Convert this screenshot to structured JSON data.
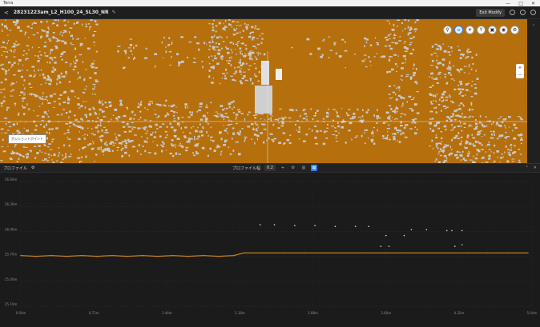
{
  "titlebar": {
    "app": "Terra",
    "minimize": "—",
    "maximize": "□",
    "close": "✕"
  },
  "header": {
    "back": "<",
    "title": "28231223am_L2_H100_24_SL30_NR",
    "edit_mode_label": "Exit Modify"
  },
  "viewport": {
    "position_label": "ポジショントポイント",
    "tools": [
      "pin-icon",
      "layers-icon",
      "bulb-icon",
      "fork-icon",
      "cube-icon",
      "camera-icon",
      "settings-icon"
    ],
    "side_tools": [
      "zoom-in-icon",
      "zoom-out-icon"
    ],
    "colors": {
      "ground": "#b56f0c",
      "noise": "#c9c9c9"
    }
  },
  "chartbar": {
    "left_label": "プロファイル",
    "density_label": "プロファイル幅",
    "density_value": "0.2",
    "zoom_buttons": [
      "0/1",
      "1/1",
      "1/1"
    ]
  },
  "chart_data": {
    "type": "scatter",
    "title": "",
    "xlabel": "",
    "ylabel": "",
    "y_ticks": [
      "26.60m",
      "26.30m",
      "26.00m",
      "25.70m",
      "25.40m",
      "25.10m"
    ],
    "x_ticks": [
      "0.00m",
      "0.72m",
      "1.44m",
      "2.16m",
      "2.88m",
      "3.60m",
      "4.32m",
      "5.04m"
    ],
    "ylim": [
      25.1,
      26.6
    ],
    "xlim": [
      0,
      5.04
    ],
    "series": [
      {
        "color": "#c47f1a",
        "points": [
          [
            0.0,
            25.71
          ],
          [
            0.15,
            25.7
          ],
          [
            0.3,
            25.71
          ],
          [
            0.45,
            25.7
          ],
          [
            0.6,
            25.71
          ],
          [
            0.75,
            25.7
          ],
          [
            0.9,
            25.71
          ],
          [
            1.05,
            25.7
          ],
          [
            1.2,
            25.71
          ],
          [
            1.35,
            25.7
          ],
          [
            1.5,
            25.71
          ],
          [
            1.65,
            25.7
          ],
          [
            1.8,
            25.71
          ],
          [
            1.95,
            25.7
          ],
          [
            2.1,
            25.71
          ],
          [
            2.2,
            25.74
          ],
          [
            2.3,
            25.74
          ],
          [
            2.4,
            25.74
          ],
          [
            2.6,
            25.74
          ],
          [
            2.8,
            25.74
          ],
          [
            3.0,
            25.74
          ],
          [
            3.2,
            25.74
          ],
          [
            3.4,
            25.74
          ],
          [
            3.5,
            25.74
          ],
          [
            3.6,
            25.74
          ],
          [
            3.8,
            25.74
          ],
          [
            4.0,
            25.74
          ],
          [
            4.2,
            25.74
          ],
          [
            4.4,
            25.74
          ],
          [
            4.6,
            25.74
          ],
          [
            4.8,
            25.74
          ],
          [
            5.0,
            25.74
          ]
        ]
      },
      {
        "color": "#d8d8d8",
        "points": [
          [
            2.36,
            26.08
          ],
          [
            2.5,
            26.08
          ],
          [
            2.7,
            26.07
          ],
          [
            2.9,
            26.07
          ],
          [
            3.1,
            26.06
          ],
          [
            3.3,
            26.06
          ],
          [
            3.43,
            26.06
          ],
          [
            3.6,
            25.95
          ],
          [
            3.78,
            25.95
          ],
          [
            3.85,
            26.02
          ],
          [
            4.0,
            26.02
          ],
          [
            4.2,
            26.01
          ],
          [
            4.25,
            26.01
          ],
          [
            4.35,
            26.01
          ],
          [
            3.55,
            25.82
          ],
          [
            3.63,
            25.82
          ],
          [
            4.28,
            25.82
          ],
          [
            4.35,
            25.84
          ]
        ]
      }
    ]
  }
}
